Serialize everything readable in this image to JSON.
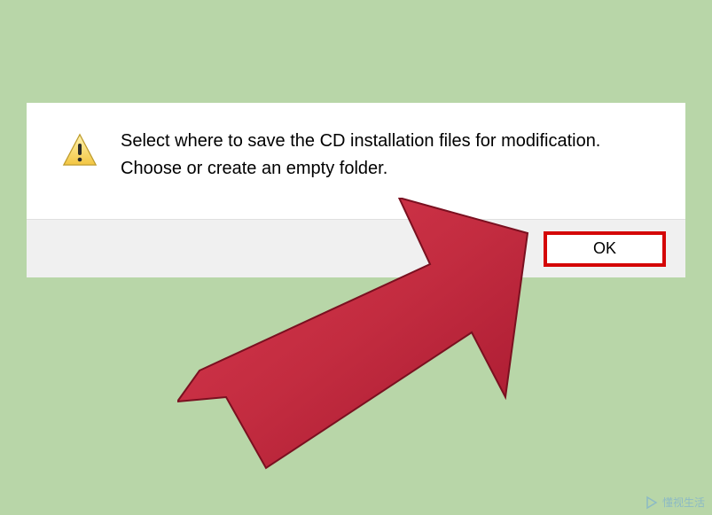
{
  "dialog": {
    "message": "Select where to save the CD installation files for modification. Choose or create an empty folder.",
    "ok_label": "OK"
  },
  "annotation": {
    "highlight_color": "#d40606",
    "arrow_color": "#c32c40"
  },
  "watermark": {
    "text": "懂视生活"
  }
}
